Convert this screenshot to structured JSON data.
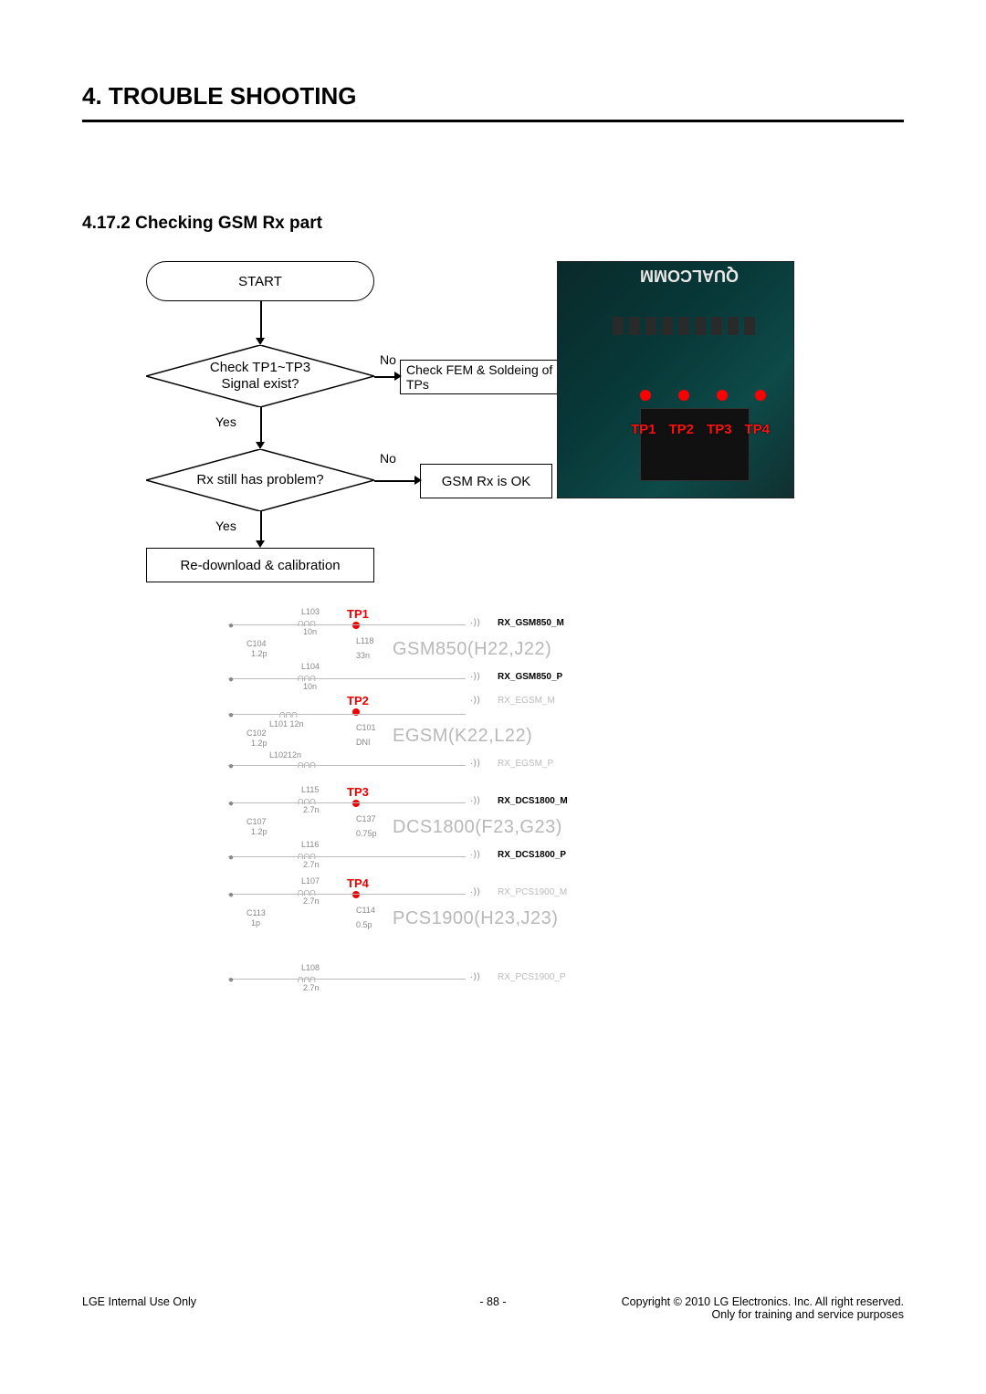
{
  "chapter_title": "4. TROUBLE SHOOTING",
  "section_heading": "4.17.2 Checking GSM Rx part",
  "flow": {
    "start": "START",
    "d1_line1": "Check TP1~TP3",
    "d1_line2": "Signal exist?",
    "d2": "Rx still has problem?",
    "p_fem": "Check FEM & Soldeing of TPs",
    "p_ok": "GSM Rx is OK",
    "p_recal": "Re-download & calibration",
    "yes": "Yes",
    "no": "No"
  },
  "pcb": {
    "brand": "QUALCOMM",
    "tp1": "TP1",
    "tp2": "TP2",
    "tp3": "TP3",
    "tp4": "TP4"
  },
  "schematic": {
    "bands": [
      {
        "tp": "TP1",
        "label": "GSM850(H22,J22)",
        "sig_top": "RX_GSM850_M",
        "sig_bot": "RX_GSM850_P",
        "comps": {
          "l_top": "L103",
          "l_top_val": "10n",
          "c_left": "C104",
          "c_left_val": "1.2p",
          "l_right": "L118",
          "l_right_val": "33n",
          "l_bot": "L104",
          "l_bot_val": "10n"
        }
      },
      {
        "tp": "TP2",
        "label": "EGSM(K22,L22)",
        "sig_top": "RX_EGSM_M",
        "sig_bot": "RX_EGSM_P",
        "comps": {
          "l_top": "L101 12n",
          "c_left": "C102",
          "c_left_val": "1.2p",
          "c_right": "C101",
          "c_right_val": "DNI",
          "l_bot": "L10212n"
        }
      },
      {
        "tp": "TP3",
        "label": "DCS1800(F23,G23)",
        "sig_top": "RX_DCS1800_M",
        "sig_bot": "RX_DCS1800_P",
        "comps": {
          "l_top": "L115",
          "l_top_val": "2.7n",
          "c_left": "C107",
          "c_left_val": "1.2p",
          "c_right": "C137",
          "c_right_val": "0.75p",
          "l_bot": "L116",
          "l_bot_val": "2.7n"
        }
      },
      {
        "tp": "TP4",
        "label": "PCS1900(H23,J23)",
        "sig_top": "RX_PCS1900_M",
        "sig_bot": "RX_PCS1900_P",
        "comps": {
          "l_top": "L107",
          "l_top_val": "2.7n",
          "c_left": "C113",
          "c_left_val": "1p",
          "c_right": "C114",
          "c_right_val": "0.5p",
          "l_bot": "L108",
          "l_bot_val": "2.7n"
        }
      }
    ]
  },
  "footer": {
    "left": "LGE Internal Use Only",
    "center": "- 88 -",
    "right1": "Copyright © 2010 LG Electronics. Inc. All right reserved.",
    "right2": "Only for training and service purposes"
  }
}
